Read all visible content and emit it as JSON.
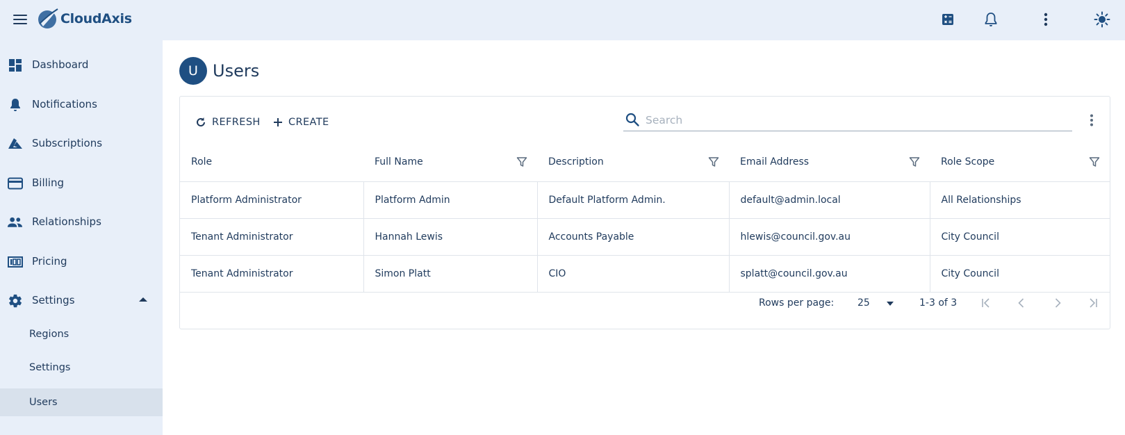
{
  "app": {
    "name": "CloudAxis"
  },
  "sidebar": {
    "items": [
      {
        "label": "Dashboard",
        "icon": "dashboard-icon"
      },
      {
        "label": "Notifications",
        "icon": "bell-icon"
      },
      {
        "label": "Subscriptions",
        "icon": "azure-icon"
      },
      {
        "label": "Billing",
        "icon": "credit-card-icon"
      },
      {
        "label": "Relationships",
        "icon": "people-icon"
      },
      {
        "label": "Pricing",
        "icon": "pricing-icon"
      },
      {
        "label": "Settings",
        "icon": "gear-icon",
        "expanded": true
      }
    ],
    "sub_items": [
      {
        "label": "Regions"
      },
      {
        "label": "Settings"
      },
      {
        "label": "Users",
        "active": true
      }
    ]
  },
  "page": {
    "avatar_letter": "U",
    "title": "Users"
  },
  "toolbar": {
    "refresh_label": "REFRESH",
    "create_label": "CREATE",
    "search_placeholder": "Search",
    "search_value": ""
  },
  "table": {
    "columns": [
      "Role",
      "Full Name",
      "Description",
      "Email Address",
      "Role Scope"
    ],
    "rows": [
      [
        "Platform Administrator",
        "Platform Admin",
        "Default Platform Admin.",
        "default@admin.local",
        "All Relationships"
      ],
      [
        "Tenant Administrator",
        "Hannah Lewis",
        "Accounts Payable",
        "hlewis@council.gov.au",
        "City Council"
      ],
      [
        "Tenant Administrator",
        "Simon Platt",
        "CIO",
        "splatt@council.gov.au",
        "City Council"
      ]
    ]
  },
  "pagination": {
    "rows_per_page_label": "Rows per page:",
    "rows_per_page": "25",
    "range": "1-3 of 3"
  },
  "colors": {
    "accent": "#1f4f82",
    "sidebar_bg": "#e8eff9",
    "text": "#1f3a5c",
    "active_bg": "#d8e1ec"
  }
}
